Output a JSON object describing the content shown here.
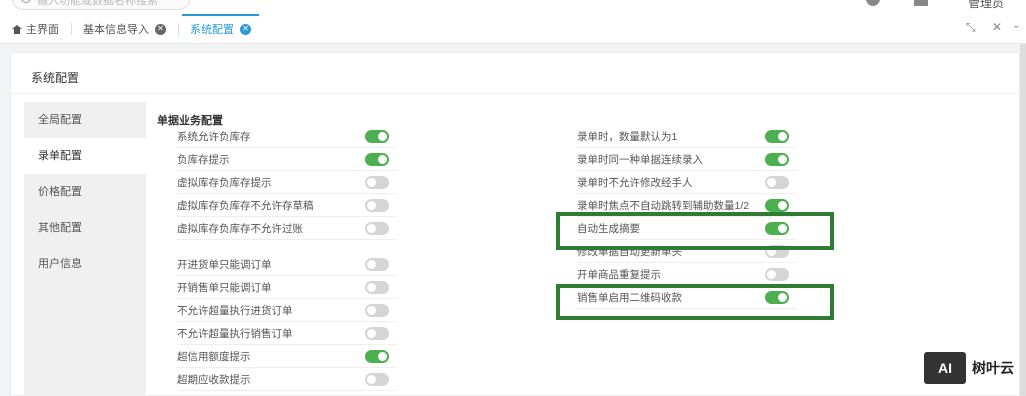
{
  "search": {
    "placeholder": "输入功能或数据名称搜索"
  },
  "user": {
    "name": "管理员"
  },
  "tabs": [
    {
      "label": "主界面"
    },
    {
      "label": "基本信息导入"
    },
    {
      "label": "系统配置"
    }
  ],
  "panel": {
    "title": "系统配置"
  },
  "sidebar": {
    "items": [
      {
        "label": "全局配置"
      },
      {
        "label": "录单配置"
      },
      {
        "label": "价格配置"
      },
      {
        "label": "其他配置"
      },
      {
        "label": "用户信息"
      }
    ]
  },
  "section": {
    "title": "单据业务配置"
  },
  "left_options": [
    {
      "label": "系统允许负库存",
      "on": true
    },
    {
      "label": "负库存提示",
      "on": true
    },
    {
      "label": "虚拟库存负库存提示",
      "on": false
    },
    {
      "label": "虚拟库存负库存不允许存草稿",
      "on": false
    },
    {
      "label": "虚拟库存负库存不允许过账",
      "on": false
    },
    {
      "label": "开进货单只能调订单",
      "on": false
    },
    {
      "label": "开销售单只能调订单",
      "on": false
    },
    {
      "label": "不允许超量执行进货订单",
      "on": false
    },
    {
      "label": "不允许超量执行销售订单",
      "on": false
    },
    {
      "label": "超信用额度提示",
      "on": true
    },
    {
      "label": "超期应收款提示",
      "on": false
    }
  ],
  "right_options": [
    {
      "label": "录单时，数量默认为1",
      "on": true
    },
    {
      "label": "录单时同一种单据连续录入",
      "on": true
    },
    {
      "label": "录单时不允许修改经手人",
      "on": false
    },
    {
      "label": "录单时焦点不自动跳转到辅助数量1/2",
      "on": true
    },
    {
      "label": "自动生成摘要",
      "on": true
    },
    {
      "label": "修改单据自动更新单头",
      "on": false
    },
    {
      "label": "开单商品重复提示",
      "on": false
    },
    {
      "label": "销售单启用二维码收款",
      "on": true
    }
  ],
  "branding": {
    "badge": "AI",
    "name": "树叶云"
  },
  "colors": {
    "accent": "#2a9ad6",
    "toggle_on": "#4caf50",
    "highlight": "#2e7d32"
  }
}
